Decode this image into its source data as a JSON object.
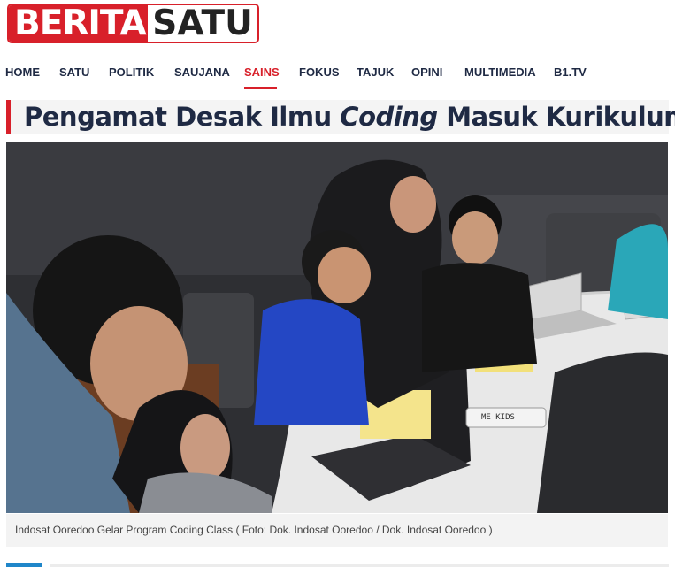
{
  "logo": {
    "part1": "BERITA",
    "part2": "SATU"
  },
  "nav": {
    "items": [
      {
        "label": "HOME"
      },
      {
        "label": "SATU"
      },
      {
        "label": "POLITIK"
      },
      {
        "label": "SAUJANA"
      },
      {
        "label": "SAINS"
      },
      {
        "label": "FOKUS"
      },
      {
        "label": "TAJUK"
      },
      {
        "label": "OPINI"
      },
      {
        "label": "MULTIMEDIA"
      },
      {
        "label": "B1.TV"
      }
    ],
    "active": "SAINS"
  },
  "article": {
    "title_before": "Pengamat Desak Ilmu ",
    "title_emphasis": "Coding",
    "title_after": " Masuk Kurikulum",
    "caption": "Indosat Ooredoo Gelar Program Coding Class ( Foto: Dok. Indosat Ooredoo / Dok. Indosat Ooredoo )",
    "photo_label": "ME KIDS"
  },
  "colors": {
    "brand_red": "#d8202a",
    "nav_text": "#1f2a44",
    "accent_blue": "#1f86c9"
  }
}
